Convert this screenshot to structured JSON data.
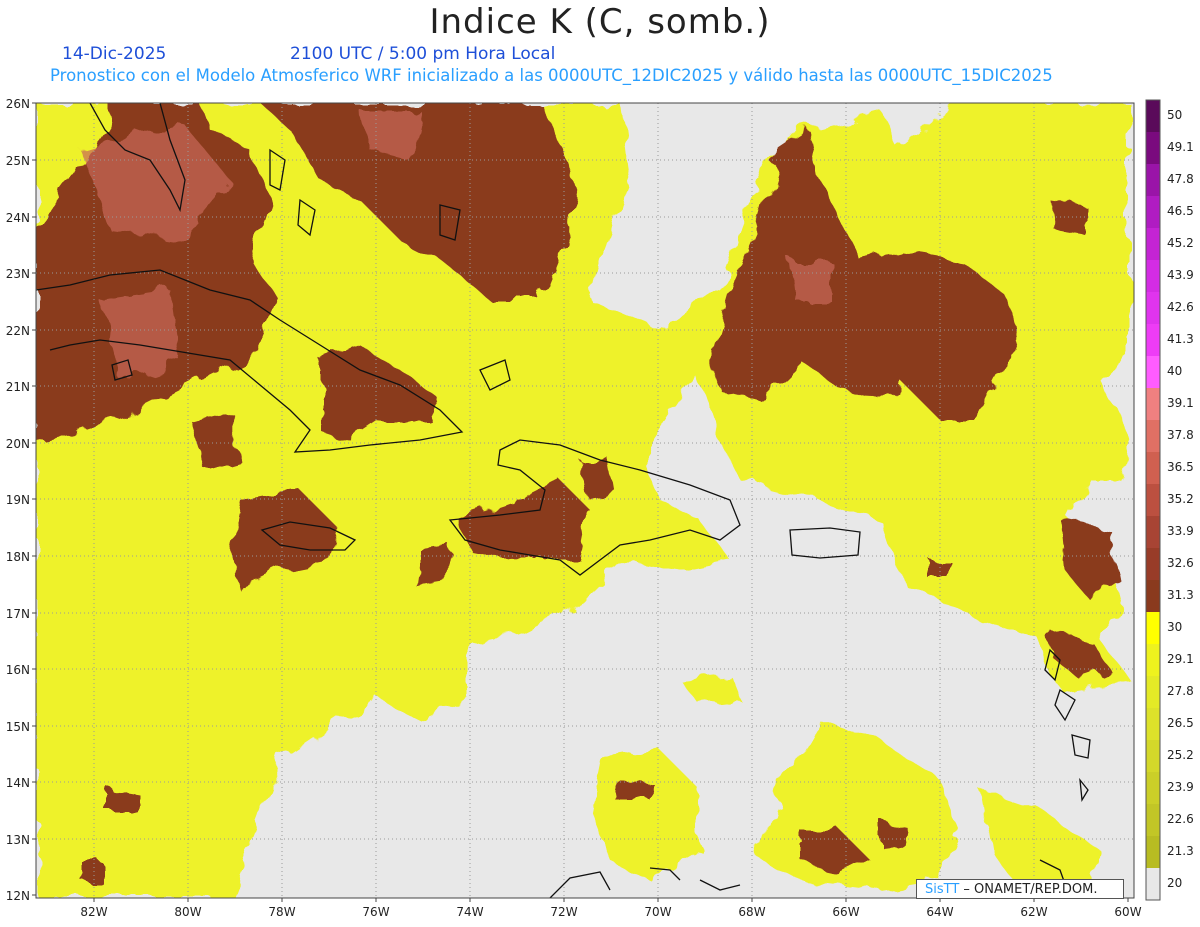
{
  "title": "Indice K (C, somb.)",
  "date": "14-Dic-2025",
  "time_line": "2100 UTC / 5:00 pm Hora Local",
  "model_line": "Pronostico con el Modelo Atmosferico WRF inicializado a las 0000UTC_12DIC2025 y válido hasta las  0000UTC_15DIC2025",
  "credit": {
    "brand": "SisTT",
    "rest": " – ONAMET/REP.DOM."
  },
  "map": {
    "lon_range": [
      -83.2,
      -59.8
    ],
    "lat_range": [
      11.9,
      26.1
    ],
    "lat_ticks": [
      "26N",
      "25N",
      "24N",
      "23N",
      "22N",
      "21N",
      "20N",
      "19N",
      "18N",
      "17N",
      "16N",
      "15N",
      "14N",
      "13N",
      "12N"
    ],
    "lon_ticks": [
      "82W",
      "80W",
      "78W",
      "76W",
      "74W",
      "72W",
      "70W",
      "68W",
      "66W",
      "64W",
      "62W",
      "60W"
    ],
    "colors": {
      "land_bg": "#e8e8e8",
      "yellow": "#eef22a",
      "brown": "#8a3a1e",
      "coast": "#111111"
    }
  },
  "colorbar": {
    "labels": [
      "50",
      "49.1",
      "47.8",
      "46.5",
      "45.2",
      "43.9",
      "42.6",
      "41.3",
      "40",
      "39.1",
      "37.8",
      "36.5",
      "35.2",
      "33.9",
      "32.6",
      "31.3",
      "30",
      "29.1",
      "27.8",
      "26.5",
      "25.2",
      "23.9",
      "22.6",
      "21.3",
      "20"
    ],
    "colors": [
      "#5a0a5a",
      "#7a0a7e",
      "#9a14a8",
      "#b01cc2",
      "#c424d4",
      "#d42ce4",
      "#e034ee",
      "#ee3cf6",
      "#ff5cff",
      "#f08080",
      "#e07064",
      "#d06050",
      "#bc5040",
      "#a84434",
      "#983c28",
      "#8a3a1e",
      "#ffff00",
      "#eef21e",
      "#e4ea26",
      "#dde22a",
      "#d4d82a",
      "#cbcf28",
      "#c2c626",
      "#b8bc22",
      "#e8e8e8"
    ]
  }
}
